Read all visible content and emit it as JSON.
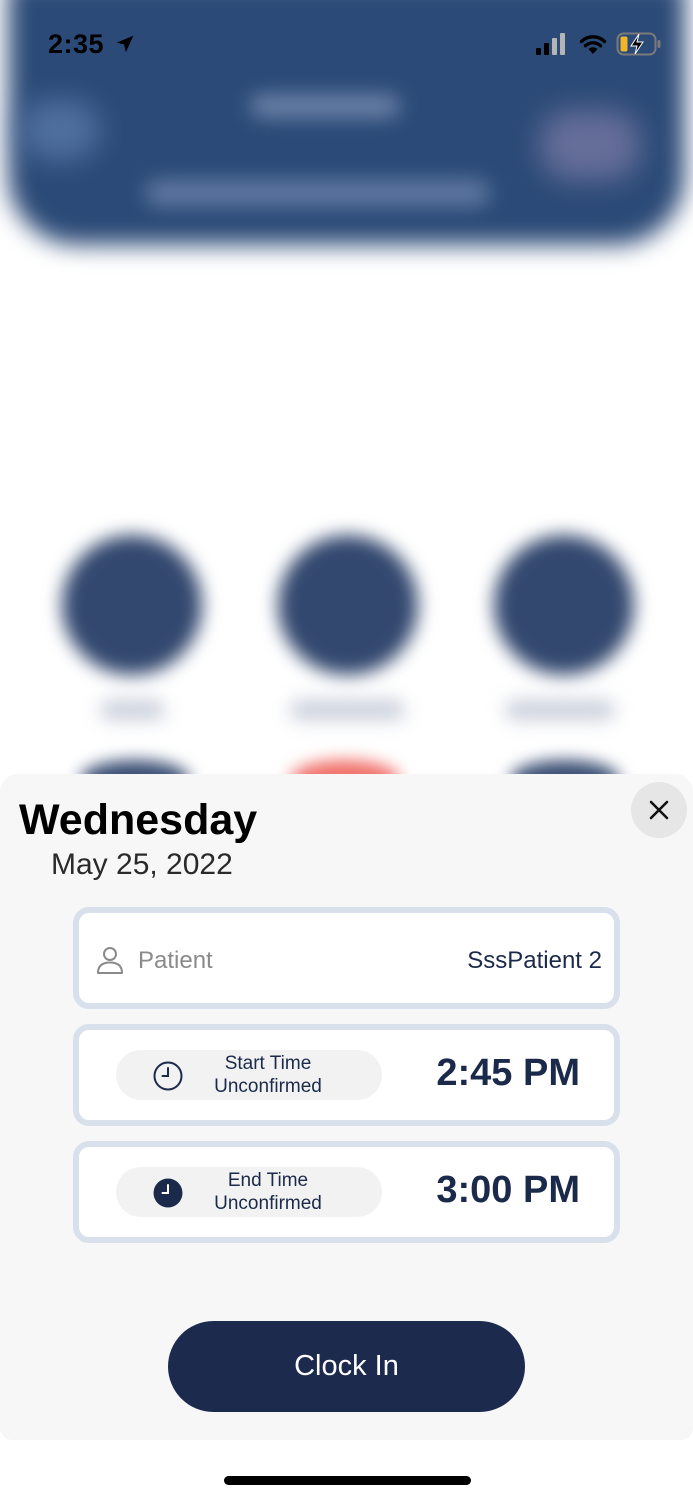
{
  "status_bar": {
    "time": "2:35"
  },
  "sheet": {
    "day": "Wednesday",
    "date": "May 25, 2022",
    "patient": {
      "label": "Patient",
      "value": "SssPatient 2"
    },
    "start": {
      "label_line1": "Start Time",
      "label_line2": "Unconfirmed",
      "time": "2:45 PM"
    },
    "end": {
      "label_line1": "End Time",
      "label_line2": "Unconfirmed",
      "time": "3:00 PM"
    },
    "clock_in_label": "Clock In"
  },
  "colors": {
    "navy": "#1c2a4e",
    "card_border": "#d8e0ec",
    "sheet_bg": "#f7f7f7"
  }
}
